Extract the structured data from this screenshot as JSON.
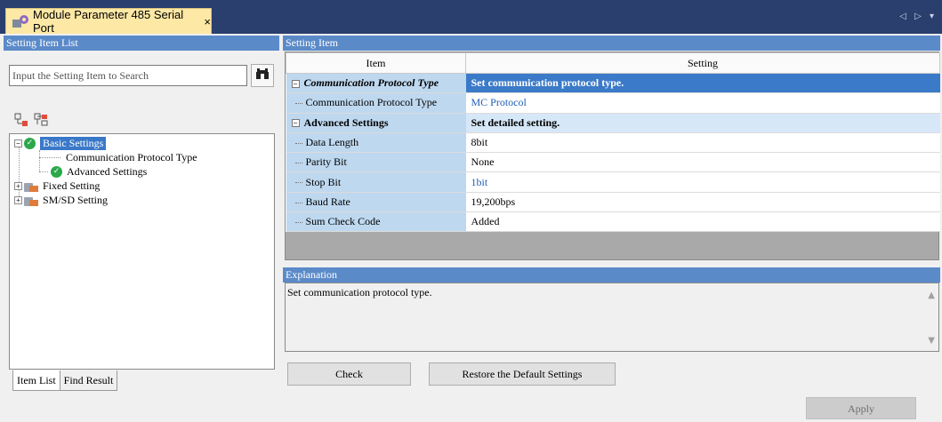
{
  "tab": {
    "title": "Module Parameter 485 Serial Port",
    "close": "×",
    "icon": "module-parameter-icon",
    "controls": "◁ ▷ ▾"
  },
  "left_panel": {
    "header": "Setting Item List",
    "search_placeholder": "Input the Setting Item to Search",
    "search_icon": "binoculars-icon",
    "tree": {
      "basic": "Basic Settings",
      "comm_protocol": "Communication Protocol Type",
      "advanced": "Advanced Settings",
      "fixed": "Fixed Setting",
      "smsd": "SM/SD Setting"
    },
    "bottom_tabs": [
      "Item List",
      "Find Result"
    ]
  },
  "setting_item": {
    "header": "Setting Item",
    "columns": [
      "Item",
      "Setting"
    ],
    "groups": [
      {
        "name": "Communication Protocol Type",
        "description": "Set communication protocol type.",
        "rows": [
          {
            "item": "Communication Protocol Type",
            "setting": "MC Protocol"
          }
        ]
      },
      {
        "name": "Advanced Settings",
        "description": "Set detailed setting.",
        "rows": [
          {
            "item": "Data Length",
            "setting": "8bit"
          },
          {
            "item": "Parity Bit",
            "setting": "None"
          },
          {
            "item": "Stop Bit",
            "setting": "1bit"
          },
          {
            "item": "Baud Rate",
            "setting": "19,200bps"
          },
          {
            "item": "Sum Check Code",
            "setting": "Added"
          }
        ]
      }
    ]
  },
  "explanation": {
    "header": "Explanation",
    "text": "Set communication protocol type."
  },
  "buttons": {
    "check": "Check",
    "restore": "Restore the Default Settings",
    "apply": "Apply"
  },
  "colors": {
    "panel_header": "#5b8ac9",
    "tab_bg": "#fde8a6",
    "selected_row": "#3b7ac8",
    "changed_value": "#1f5fb4",
    "ok_check": "#2aa84a"
  }
}
